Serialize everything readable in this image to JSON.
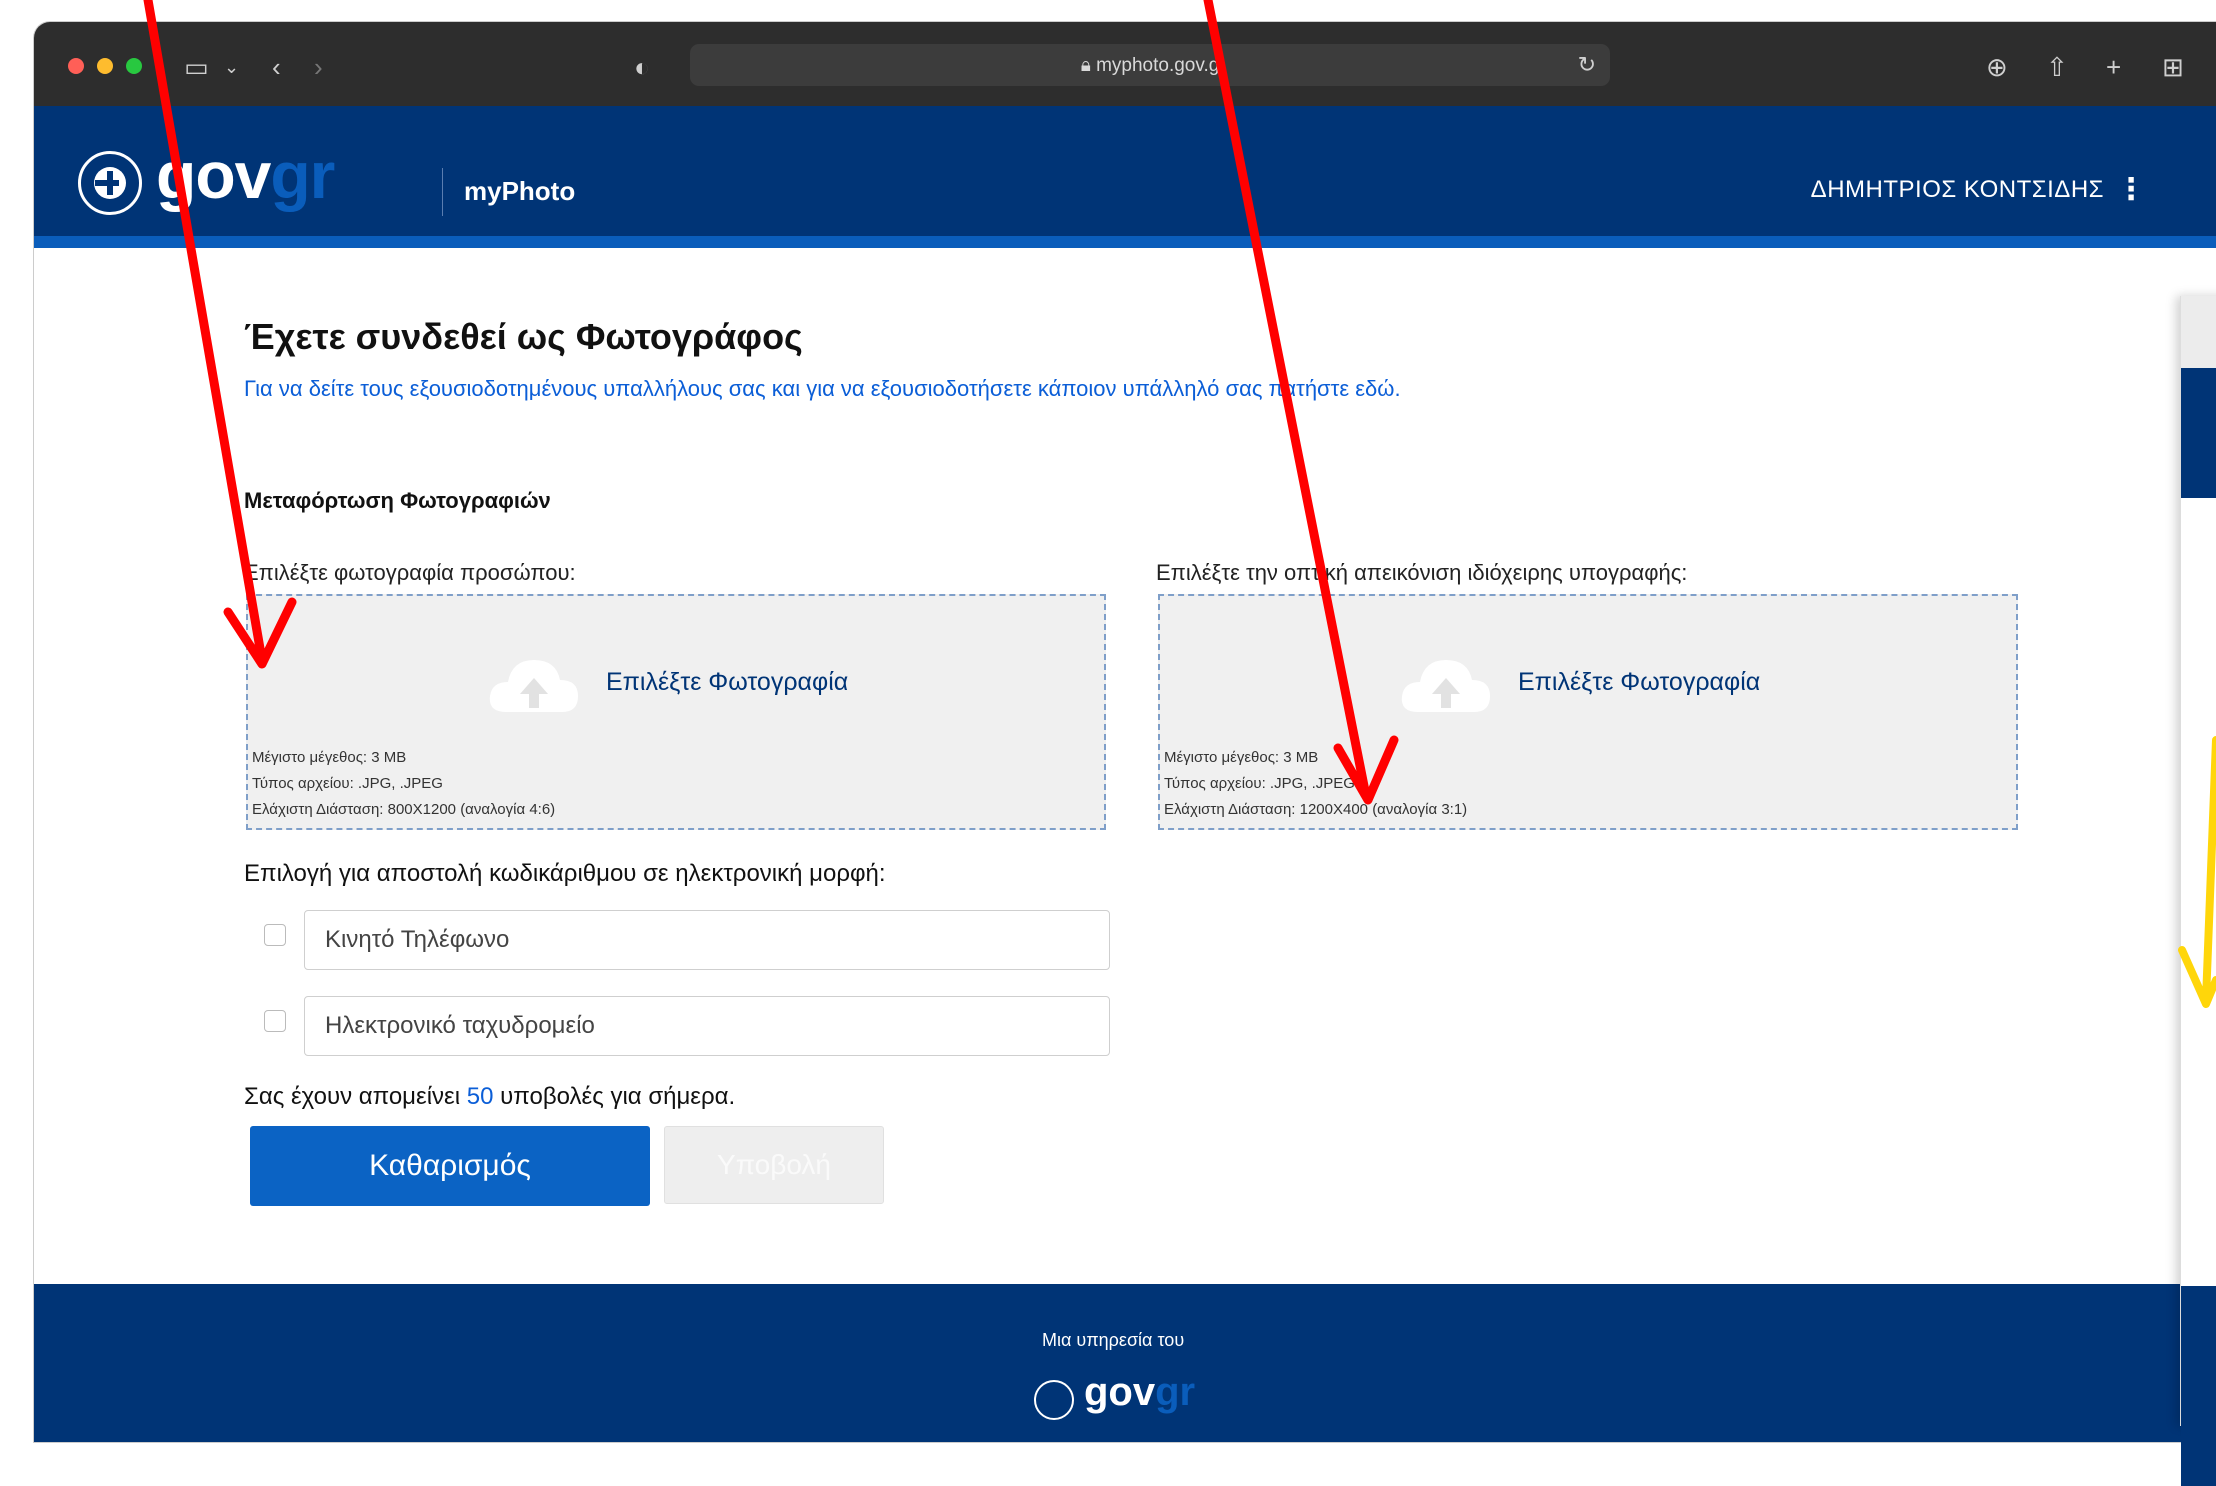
{
  "browser": {
    "url": "myphoto.gov.g",
    "icons": [
      "sidebar-icon",
      "chevron-down-icon",
      "back-icon",
      "forward-icon",
      "shield-icon",
      "lock-icon",
      "reload-icon",
      "download-icon",
      "share-icon",
      "plus-icon",
      "tabs-icon"
    ]
  },
  "header": {
    "logo_main": "gov",
    "logo_accent": "gr",
    "service_name": "myPhoto",
    "user_name": "ΔΗΜΗΤΡΙΟΣ ΚΟΝΤΣΙΔΗΣ",
    "menu_icon": "⋮"
  },
  "main": {
    "title": "Έχετε συνδεθεί ως Φωτογράφος",
    "auth_link": "Για να δείτε τους εξουσιοδοτημένους υπαλλήλους σας και για να εξουσιοδοτήσετε κάποιον υπάλληλό σας πατήστε εδώ.",
    "section_title": "Μεταφόρτωση Φωτογραφιών",
    "face_photo": {
      "label": "Επιλέξτε φωτογραφία προσώπου:",
      "choose": "Επιλέξτε Φωτογραφία",
      "max_size": "Μέγιστο μέγεθος: 3 MB",
      "file_type": "Τύπος αρχείου: .JPG, .JPEG",
      "min_dimension": "Ελάχιστη Διάσταση: 800X1200 (αναλογία 4:6)"
    },
    "signature": {
      "label": "Επιλέξτε την οπτική απεικόνιση ιδιόχειρης υπογραφής:",
      "choose": "Επιλέξτε Φωτογραφία",
      "max_size": "Μέγιστο μέγεθος: 3 MB",
      "file_type": "Τύπος αρχείου: .JPG, .JPEG",
      "min_dimension": "Ελάχιστη Διάσταση: 1200X400 (αναλογία 3:1)"
    },
    "barcode_label": "Επιλογή για αποστολή κωδικάριθμου σε ηλεκτρονική μορφή:",
    "phone_placeholder": "Κινητό Τηλέφωνο",
    "email_placeholder": "Ηλεκτρονικό ταχυδρομείο",
    "remaining_prefix": "Σας έχουν απομείνει",
    "remaining_count": "50",
    "remaining_suffix": "υποβολές για σήμερα.",
    "clear_button": "Καθαρισμός",
    "submit_button": "Υποβολή"
  },
  "footer": {
    "service_of": "Μια υπηρεσία του",
    "logo_main": "gov",
    "logo_accent": "gr"
  },
  "colors": {
    "header_bg": "#003476",
    "accent_blue": "#0a5dbb",
    "link_blue": "#0b5ed7",
    "annotation_red": "#ff0000",
    "annotation_yellow": "#ffd60a"
  }
}
